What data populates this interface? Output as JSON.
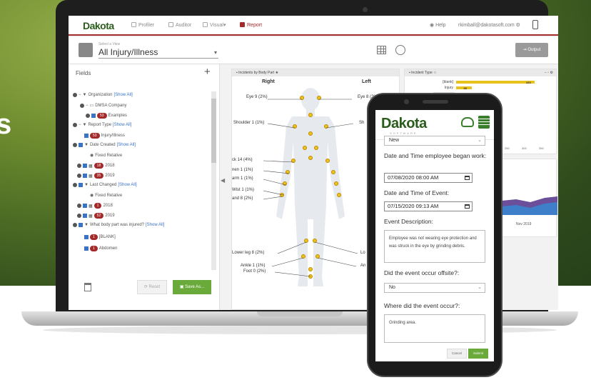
{
  "background_text": "s",
  "app": {
    "logo": "Dakota",
    "nav": [
      "Profiler",
      "Auditor",
      "Visual",
      "Report"
    ],
    "help_label": "Help",
    "user_email": "rkimball@dakotasoft.com",
    "view_sublabel": "Select a View",
    "view_name": "All Injury/Illness",
    "output_label": "Output"
  },
  "fields": {
    "title": "Fields",
    "rows": [
      {
        "label": "Organization",
        "link": "[Show All]"
      },
      {
        "label": "DMSA Company"
      },
      {
        "badge": "53",
        "label": "Examples"
      },
      {
        "label": "Report Type",
        "link": "[Show All]"
      },
      {
        "badge": "53",
        "label": "Injury/Illness"
      },
      {
        "label": "Date Created",
        "link": "[Show All]"
      },
      {
        "label": "Fixed  Relative"
      },
      {
        "badge": "18",
        "label": "2018"
      },
      {
        "badge": "35",
        "label": "2019"
      },
      {
        "label": "Last Changed",
        "link": "[Show All]"
      },
      {
        "label": "Fixed  Relative"
      },
      {
        "badge": "1",
        "label": "2018"
      },
      {
        "badge": "52",
        "label": "2019"
      },
      {
        "label": "What body part was injured?",
        "link": "[Show All]"
      },
      {
        "badge": "1",
        "label": "[BLANK]"
      },
      {
        "badge": "1",
        "label": "Abdomen"
      }
    ],
    "reset_label": "Reset",
    "saveas_label": "Save As..."
  },
  "body_chart": {
    "title": "Incidents by Body Part",
    "right_label": "Right",
    "left_label": "Left",
    "labels_right": [
      {
        "text": "Eye 9 (2%)"
      },
      {
        "text": "Shoulder 1 (1%)"
      },
      {
        "text": "ck 14 (4%)"
      },
      {
        "text": "nen 1 (1%)"
      },
      {
        "text": "arm 1 (1%)"
      },
      {
        "text": "Wist 1 (1%)"
      },
      {
        "text": "and 8 (2%)"
      },
      {
        "text": "Lower leg 8 (2%)"
      },
      {
        "text": "Ankle 1 (1%)"
      },
      {
        "text": "Foot 0 (2%)"
      }
    ],
    "labels_left": [
      {
        "text": "Eye 8 (2%)"
      },
      {
        "text": "Sh"
      },
      {
        "text": "Lo"
      },
      {
        "text": "An"
      }
    ]
  },
  "chart_data": {
    "type": "bar",
    "title": "Incident Type",
    "categories": [
      "[blank]",
      "Injury"
    ],
    "values": [
      333,
      68
    ],
    "value_labels": [
      "333",
      "68"
    ],
    "x_ticks": [
      "250",
      "300",
      "350"
    ],
    "xlabel": "",
    "ylabel": ""
  },
  "trend": {
    "x_label": "Nov 2019"
  },
  "phone": {
    "logo": "Dakota",
    "logo_sub": "SOFTWARE",
    "status_value": "New",
    "q_employee_began": "Date and Time employee began work:",
    "employee_began_value": "07/08/2020 08:00 AM",
    "q_event_time": "Date and Time of Event:",
    "event_time_value": "07/15/2020 09:13 AM",
    "q_description": "Event Description:",
    "description_value": "Employee was not wearing eye protection and was struck in the eye by grinding debris.",
    "q_offsite": "Did the event occur offsite?:",
    "offsite_value": "No",
    "q_where": "Where did the event occur?:",
    "where_value": "Grinding area.",
    "cancel_label": "Cancel",
    "submit_label": "Submit"
  },
  "colors": {
    "brand_green": "#3a7d2a",
    "accent_red": "#a32a2a",
    "button_green": "#6aaa3a",
    "bar_yellow": "#e8c31e"
  }
}
